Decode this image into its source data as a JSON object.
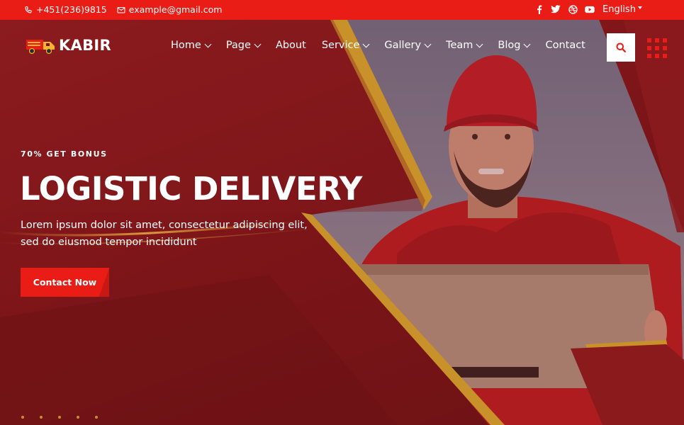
{
  "topbar": {
    "phone": "+451(236)9815",
    "email": "example@gmail.com",
    "social": [
      "facebook-icon",
      "twitter-icon",
      "dribbble-icon",
      "youtube-icon"
    ],
    "language": "English"
  },
  "header": {
    "logo_text": "KABIR",
    "nav": [
      {
        "label": "Home",
        "dropdown": true
      },
      {
        "label": "Page",
        "dropdown": true
      },
      {
        "label": "About",
        "dropdown": false
      },
      {
        "label": "Service",
        "dropdown": true
      },
      {
        "label": "Gallery",
        "dropdown": true
      },
      {
        "label": "Team",
        "dropdown": true
      },
      {
        "label": "Blog",
        "dropdown": true
      },
      {
        "label": "Contact",
        "dropdown": false
      }
    ]
  },
  "hero": {
    "eyebrow": "70% GET BONUS",
    "title": "LOGISTIC DELIVERY",
    "description": "Lorem ipsum dolor sit amet, consectetur adipiscing elit, sed do eiusmod tempor incididunt",
    "cta_label": "Contact Now"
  },
  "colors": {
    "accent": "#ea1c16",
    "hero_overlay": "#7d1519",
    "gold": "#c9912a"
  }
}
